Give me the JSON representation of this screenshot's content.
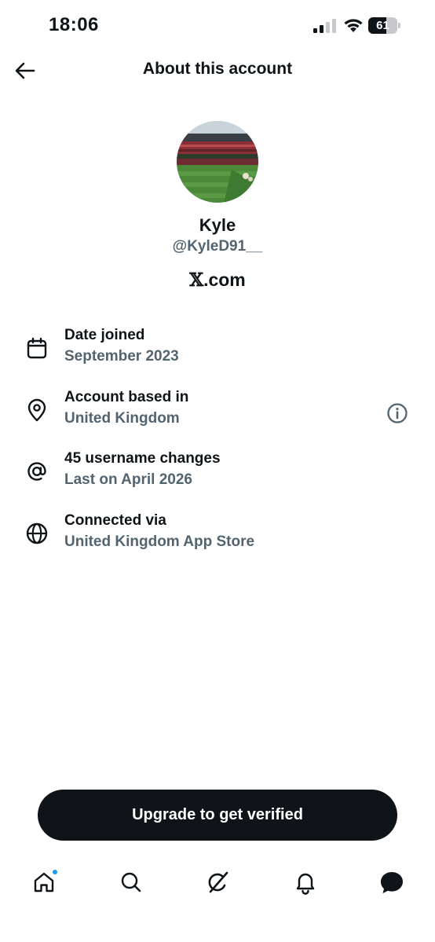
{
  "status_bar": {
    "time": "18:06",
    "battery_level": "61",
    "battery_percent": 61
  },
  "header": {
    "title": "About this account",
    "back_icon": "arrow-left-icon"
  },
  "profile": {
    "display_name": "Kyle",
    "handle": "@KyleD91__",
    "domain_glyph": "𝕏",
    "domain_suffix": ".com",
    "avatar_description_icon": "avatar-stadium-photo"
  },
  "details": [
    {
      "icon": "calendar-icon",
      "title": "Date joined",
      "value": "September 2023"
    },
    {
      "icon": "location-pin-icon",
      "title": "Account based in",
      "value": "United Kingdom",
      "has_info": true
    },
    {
      "icon": "at-sign-icon",
      "title": "45 username changes",
      "value": "Last on April 2026"
    },
    {
      "icon": "globe-icon",
      "title": "Connected via",
      "value": "United Kingdom App Store"
    }
  ],
  "upgrade_button": {
    "label": "Upgrade to get verified"
  },
  "bottom_nav": {
    "items": [
      "home-icon",
      "search-icon",
      "grok-icon",
      "notifications-bell-icon",
      "messages-icon"
    ],
    "home_has_notification_dot": true
  },
  "colors": {
    "text_primary": "#0f1419",
    "text_secondary": "#536471",
    "button_bg": "#0f1419",
    "notification_dot": "#1d9bf0"
  }
}
